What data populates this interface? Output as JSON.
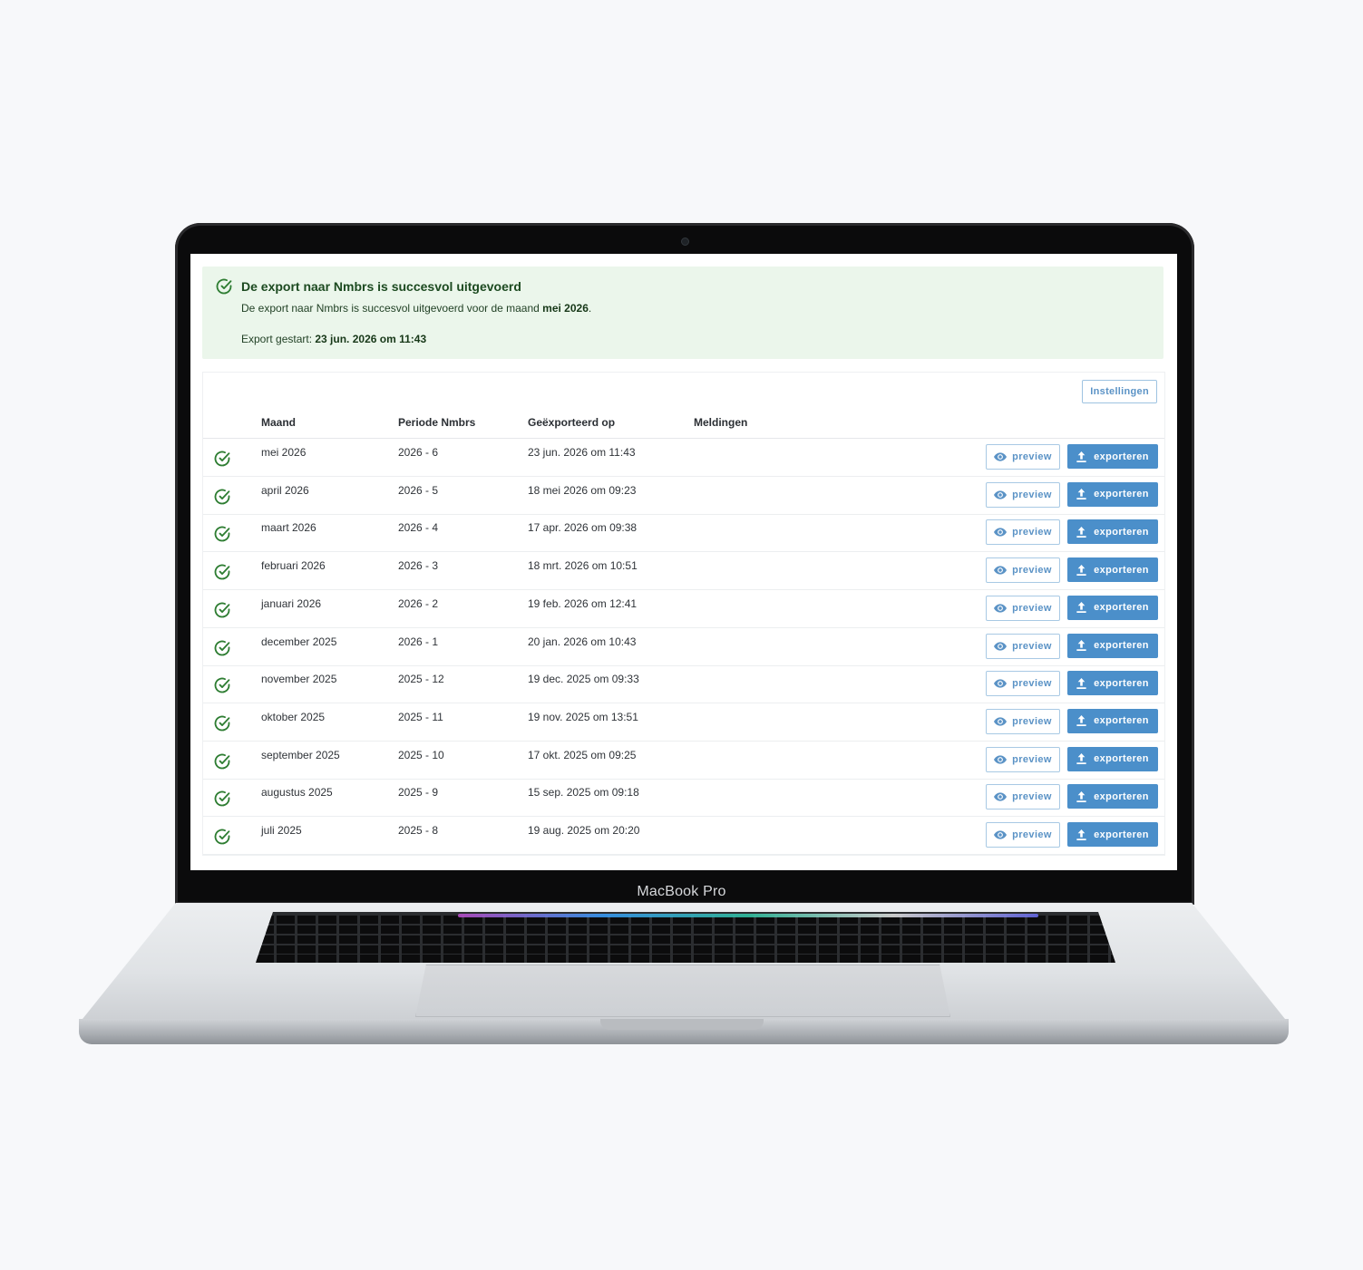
{
  "device": {
    "brand_label": "MacBook Pro"
  },
  "alert": {
    "title": "De export naar Nmbrs is succesvol uitgevoerd",
    "text_prefix": "De export naar Nmbrs is succesvol uitgevoerd voor de maand ",
    "text_month": "mei 2026",
    "text_suffix": ".",
    "started_label": "Export gestart: ",
    "started_value": "23 jun. 2026 om 11:43",
    "icon": "check-circle-icon"
  },
  "toolbar": {
    "settings_label": "Instellingen"
  },
  "table": {
    "headers": {
      "month": "Maand",
      "period": "Periode Nmbrs",
      "exported": "Geëxporteerd op",
      "messages": "Meldingen"
    },
    "preview_label": "preview",
    "export_label": "exporteren",
    "rows": [
      {
        "month": "mei 2026",
        "period": "2026 - 6",
        "exported": "23 jun. 2026 om 11:43",
        "messages": ""
      },
      {
        "month": "april 2026",
        "period": "2026 - 5",
        "exported": "18 mei 2026 om 09:23",
        "messages": ""
      },
      {
        "month": "maart 2026",
        "period": "2026 - 4",
        "exported": "17 apr. 2026 om 09:38",
        "messages": ""
      },
      {
        "month": "februari 2026",
        "period": "2026 - 3",
        "exported": "18 mrt. 2026 om 10:51",
        "messages": ""
      },
      {
        "month": "januari 2026",
        "period": "2026 - 2",
        "exported": "19 feb. 2026 om 12:41",
        "messages": ""
      },
      {
        "month": "december 2025",
        "period": "2026 - 1",
        "exported": "20 jan. 2026 om 10:43",
        "messages": ""
      },
      {
        "month": "november 2025",
        "period": "2025 - 12",
        "exported": "19 dec. 2025 om 09:33",
        "messages": ""
      },
      {
        "month": "oktober 2025",
        "period": "2025 - 11",
        "exported": "19 nov. 2025 om 13:51",
        "messages": ""
      },
      {
        "month": "september 2025",
        "period": "2025 - 10",
        "exported": "17 okt. 2025 om 09:25",
        "messages": ""
      },
      {
        "month": "augustus 2025",
        "period": "2025 - 9",
        "exported": "15 sep. 2025 om 09:18",
        "messages": ""
      },
      {
        "month": "juli 2025",
        "period": "2025 - 8",
        "exported": "19 aug. 2025 om 20:20",
        "messages": ""
      }
    ]
  },
  "colors": {
    "success": "#2e7d32",
    "accent": "#4b8fca",
    "alert_bg": "#ebf6eb"
  }
}
